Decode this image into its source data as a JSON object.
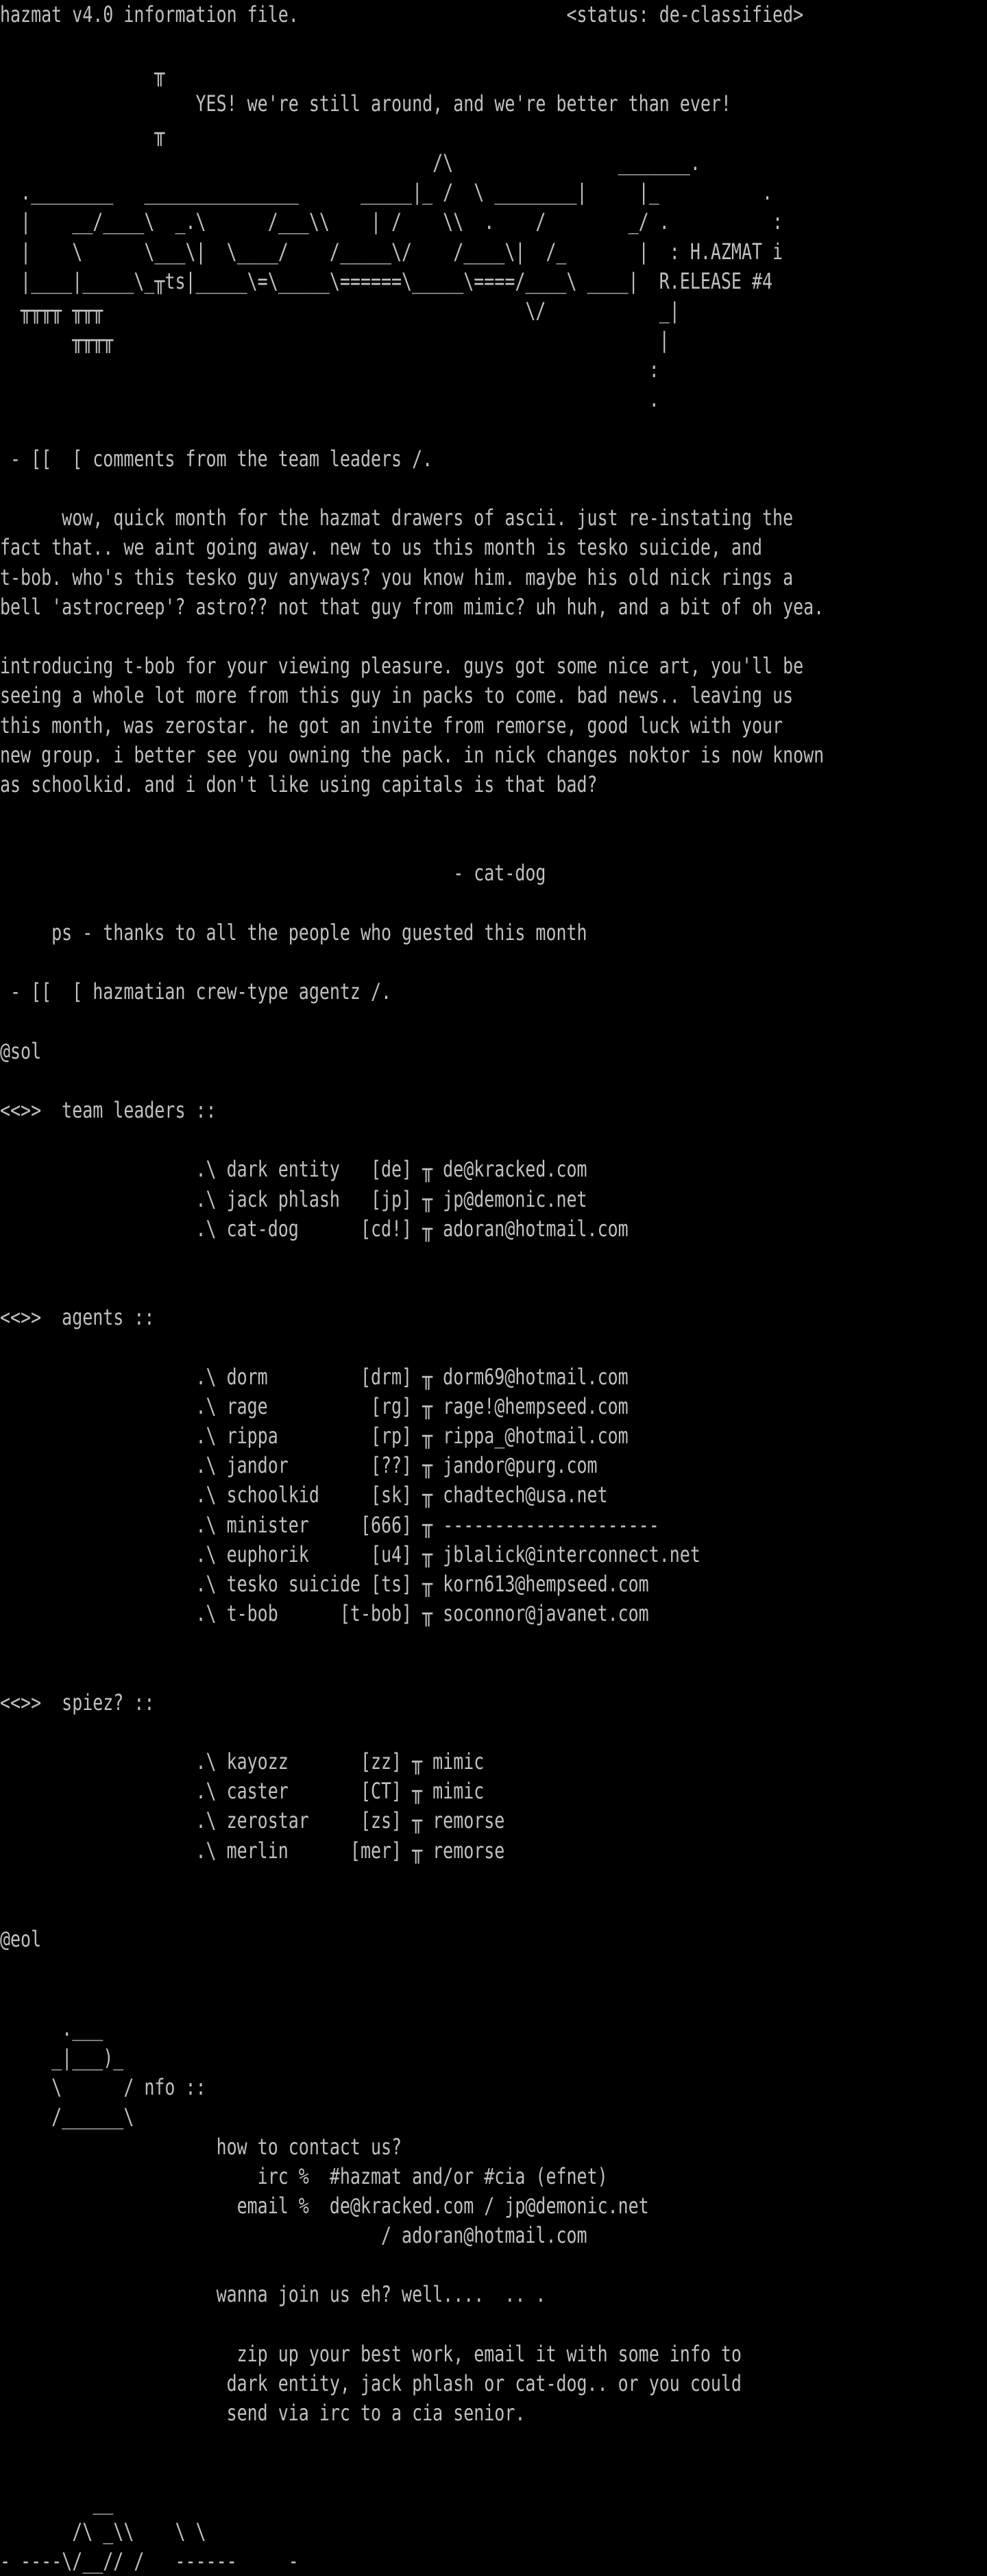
{
  "document": {
    "title": "hazmat v4.0 information file.",
    "status": "<status: de-classified>",
    "lines": [
      "hazmat v4.0 information file.                          <status: de-classified>",
      "",
      "               ╥",
      "                   YES! we're still around, and we're better than ever!",
      "               ╥",
      "                                          /\\                _______.",
      "  .________   _______________      _____|_ /  \\ ________|     |_          .",
      "  |    __/____\\  _.\\      /___\\\\    | /    \\\\  .    /        _/ .          :",
      "  |    \\      \\___\\|  \\____/    /_____\\/    /____\\|  /_       |  : H.AZMAT i",
      "  |____|_____\\_╥ts|_____\\=\\_____\\======\\_____\\====/____\\ ____|  R.ELEASE #4",
      "  ╥╥╥╥ ╥╥╥                                         \\/           _|",
      "       ╥╥╥╥                                                     |",
      "                                                               :",
      "                                                               .",
      "",
      " - [[  [ comments from the team leaders /.",
      "",
      "      wow, quick month for the hazmat drawers of ascii. just re-instating the",
      "fact that.. we aint going away. new to us this month is tesko suicide, and",
      "t-bob. who's this tesko guy anyways? you know him. maybe his old nick rings a",
      "bell 'astrocreep'? astro?? not that guy from mimic? uh huh, and a bit of oh yea.",
      "",
      "introducing t-bob for your viewing pleasure. guys got some nice art, you'll be",
      "seeing a whole lot more from this guy in packs to come. bad news.. leaving us",
      "this month, was zerostar. he got an invite from remorse, good luck with your",
      "new group. i better see you owning the pack. in nick changes noktor is now known",
      "as schoolkid. and i don't like using capitals is that bad?",
      "",
      "",
      "                                            - cat-dog",
      "",
      "     ps - thanks to all the people who guested this month",
      "",
      " - [[  [ hazmatian crew-type agentz /.",
      "",
      "@sol",
      "",
      "<<>>  team leaders ::",
      "",
      "                   .\\ dark entity   [de] ╥ de@kracked.com",
      "                   .\\ jack phlash   [jp] ╥ jp@demonic.net",
      "                   .\\ cat-dog      [cd!] ╥ adoran@hotmail.com",
      "",
      "",
      "<<>>  agents ::",
      "",
      "                   .\\ dorm         [drm] ╥ dorm69@hotmail.com",
      "                   .\\ rage          [rg] ╥ rage!@hempseed.com",
      "                   .\\ rippa         [rp] ╥ rippa_@hotmail.com",
      "                   .\\ jandor        [??] ╥ jandor@purg.com",
      "                   .\\ schoolkid     [sk] ╥ chadtech@usa.net",
      "                   .\\ minister     [666] ╥ ---------------------",
      "                   .\\ euphorik      [u4] ╥ jblalick@interconnect.net",
      "                   .\\ tesko suicide [ts] ╥ korn613@hempseed.com",
      "                   .\\ t-bob      [t-bob] ╥ soconnor@javanet.com",
      "",
      "",
      "<<>>  spiez? ::",
      "",
      "                   .\\ kayozz       [zz] ╥ mimic",
      "                   .\\ caster       [CT] ╥ mimic",
      "                   .\\ zerostar     [zs] ╥ remorse",
      "                   .\\ merlin      [mer] ╥ remorse",
      "",
      "",
      "@eol",
      "",
      "",
      "      .___",
      "     _|___)_",
      "     \\      / nfo ::",
      "     /______\\",
      "                     how to contact us?",
      "                         irc %  #hazmat and/or #cia (efnet)",
      "                       email %  de@kracked.com / jp@demonic.net",
      "                                     / adoran@hotmail.com",
      "",
      "                     wanna join us eh? well....  .. .",
      "",
      "                       zip up your best work, email it with some info to",
      "                      dark entity, jack phlash or cat-dog.. or you could",
      "                      send via irc to a cia senior.",
      "",
      "",
      "         __",
      "       /\\ _\\\\    \\ \\",
      "- ----\\/__// /   ------     -"
    ]
  },
  "colors": {
    "background": "#000000",
    "text": "#c0c0c0"
  }
}
